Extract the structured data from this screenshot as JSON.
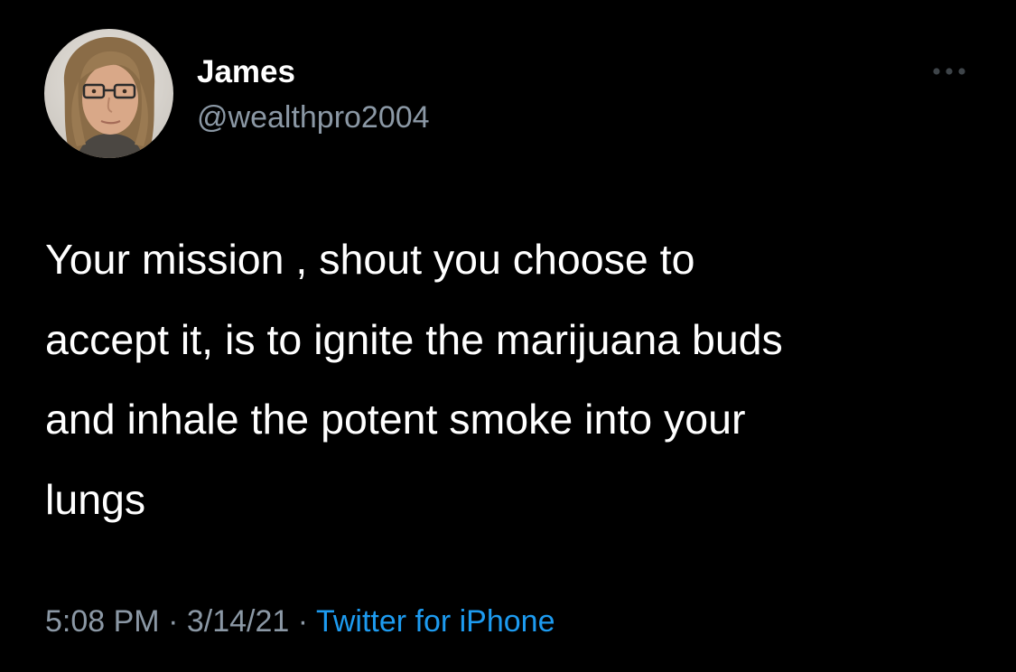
{
  "tweet": {
    "author": {
      "name": "James",
      "handle": "@wealthpro2004",
      "avatar_icon": "profile-photo"
    },
    "more_icon": "more-options-icon",
    "text": "Your mission , shout you choose to\naccept it, is to ignite the marijuana buds\nand inhale the potent smoke into your\nlungs",
    "time": "5:08 PM",
    "separator": "·",
    "date": "3/14/21",
    "source": "Twitter for iPhone"
  },
  "colors": {
    "background": "#000000",
    "text": "#ffffff",
    "secondary": "#8b98a5",
    "link": "#1d9bf0"
  }
}
